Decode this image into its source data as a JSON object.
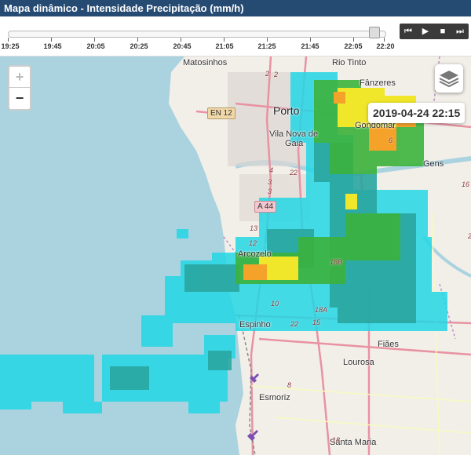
{
  "header": {
    "title": "Mapa dinâmico - Intensidade Precipitação (mm/h)"
  },
  "timeline": {
    "labels": [
      "19:25",
      "19:45",
      "20:05",
      "20:25",
      "20:45",
      "21:05",
      "21:25",
      "21:45",
      "22:05",
      "22:20"
    ],
    "current": "22:15",
    "current_fraction": 0.97,
    "controls": {
      "rewind": "⏮",
      "play": "▶",
      "stop": "■",
      "forward": "⏭"
    }
  },
  "map": {
    "zoom_in": "+",
    "zoom_out": "−",
    "timestamp": "2019-04-24 22:15",
    "places": {
      "matosinhos": "Matosinhos",
      "rio_tinto": "Rio Tinto",
      "fanzeres": "Fânzeres",
      "porto": "Porto",
      "gondomar": "Gondomar",
      "vila_nova_gaia_1": "Vila Nova de",
      "vila_nova_gaia_2": "Gaia",
      "gens": "Gens",
      "arcozelo": "Arcozelo",
      "espinho": "Espinho",
      "fiaes": "Fiães",
      "lourosa": "Lourosa",
      "esmoriz": "Esmoriz",
      "santa_maria": "Santa Maria"
    },
    "roads": {
      "en12": "EN 12",
      "a44": "A 44",
      "r2a": "2",
      "r2b": "2",
      "r4": "4",
      "r3a": "3",
      "r3b": "3",
      "r22a": "22",
      "r22b": "22",
      "r13": "13",
      "r12": "12",
      "r18b": "18B",
      "r10": "10",
      "r18a": "18A",
      "r15": "15",
      "r8": "8",
      "r18": "18",
      "r16": "16",
      "r6": "6",
      "r25": "25"
    },
    "icons": {
      "layers": "layers-icon",
      "airport": "airplane-icon"
    }
  }
}
